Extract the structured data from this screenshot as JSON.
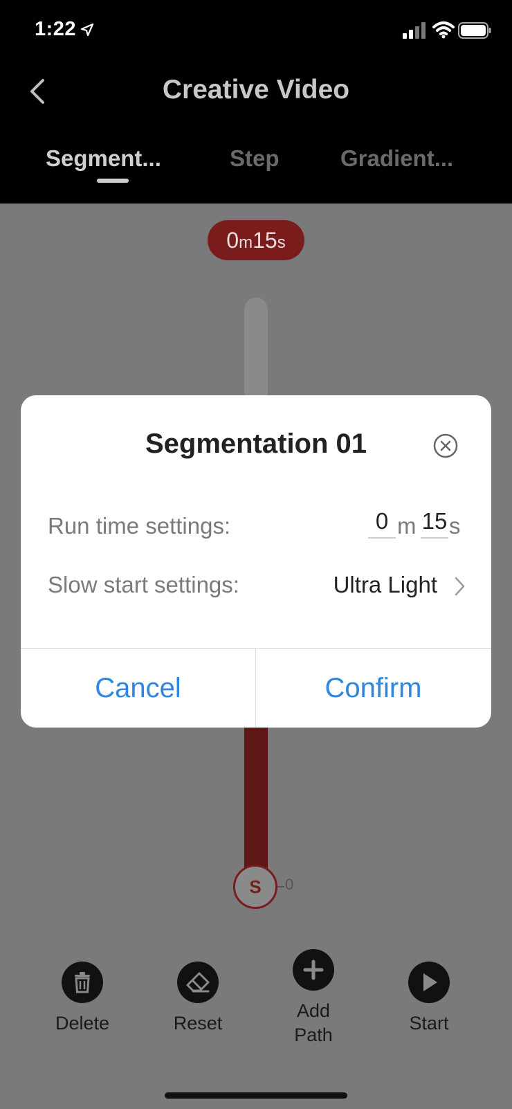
{
  "status_bar": {
    "time": "1:22"
  },
  "header": {
    "title": "Creative Video",
    "tabs": [
      {
        "label": "Segment...",
        "active": true
      },
      {
        "label": "Step",
        "active": false
      },
      {
        "label": "Gradient...",
        "active": false
      }
    ]
  },
  "timeline": {
    "duration_minutes": "0",
    "duration_m_unit": "m",
    "duration_seconds": "15",
    "duration_s_unit": "s",
    "start_node_label": "S",
    "start_position_value": "0"
  },
  "toolbar": {
    "delete_label": "Delete",
    "reset_label": "Reset",
    "add_path_label_line1": "Add",
    "add_path_label_line2": "Path",
    "start_label": "Start"
  },
  "modal": {
    "title": "Segmentation 01",
    "run_time_label": "Run time settings:",
    "run_time_minutes": "0",
    "minutes_unit": "m",
    "run_time_seconds": "15",
    "seconds_unit": "s",
    "slow_start_label": "Slow start settings:",
    "slow_start_value": "Ultra Light",
    "cancel_label": "Cancel",
    "confirm_label": "Confirm"
  },
  "colors": {
    "accent_red": "#b22222",
    "link_blue": "#2f86e0"
  }
}
